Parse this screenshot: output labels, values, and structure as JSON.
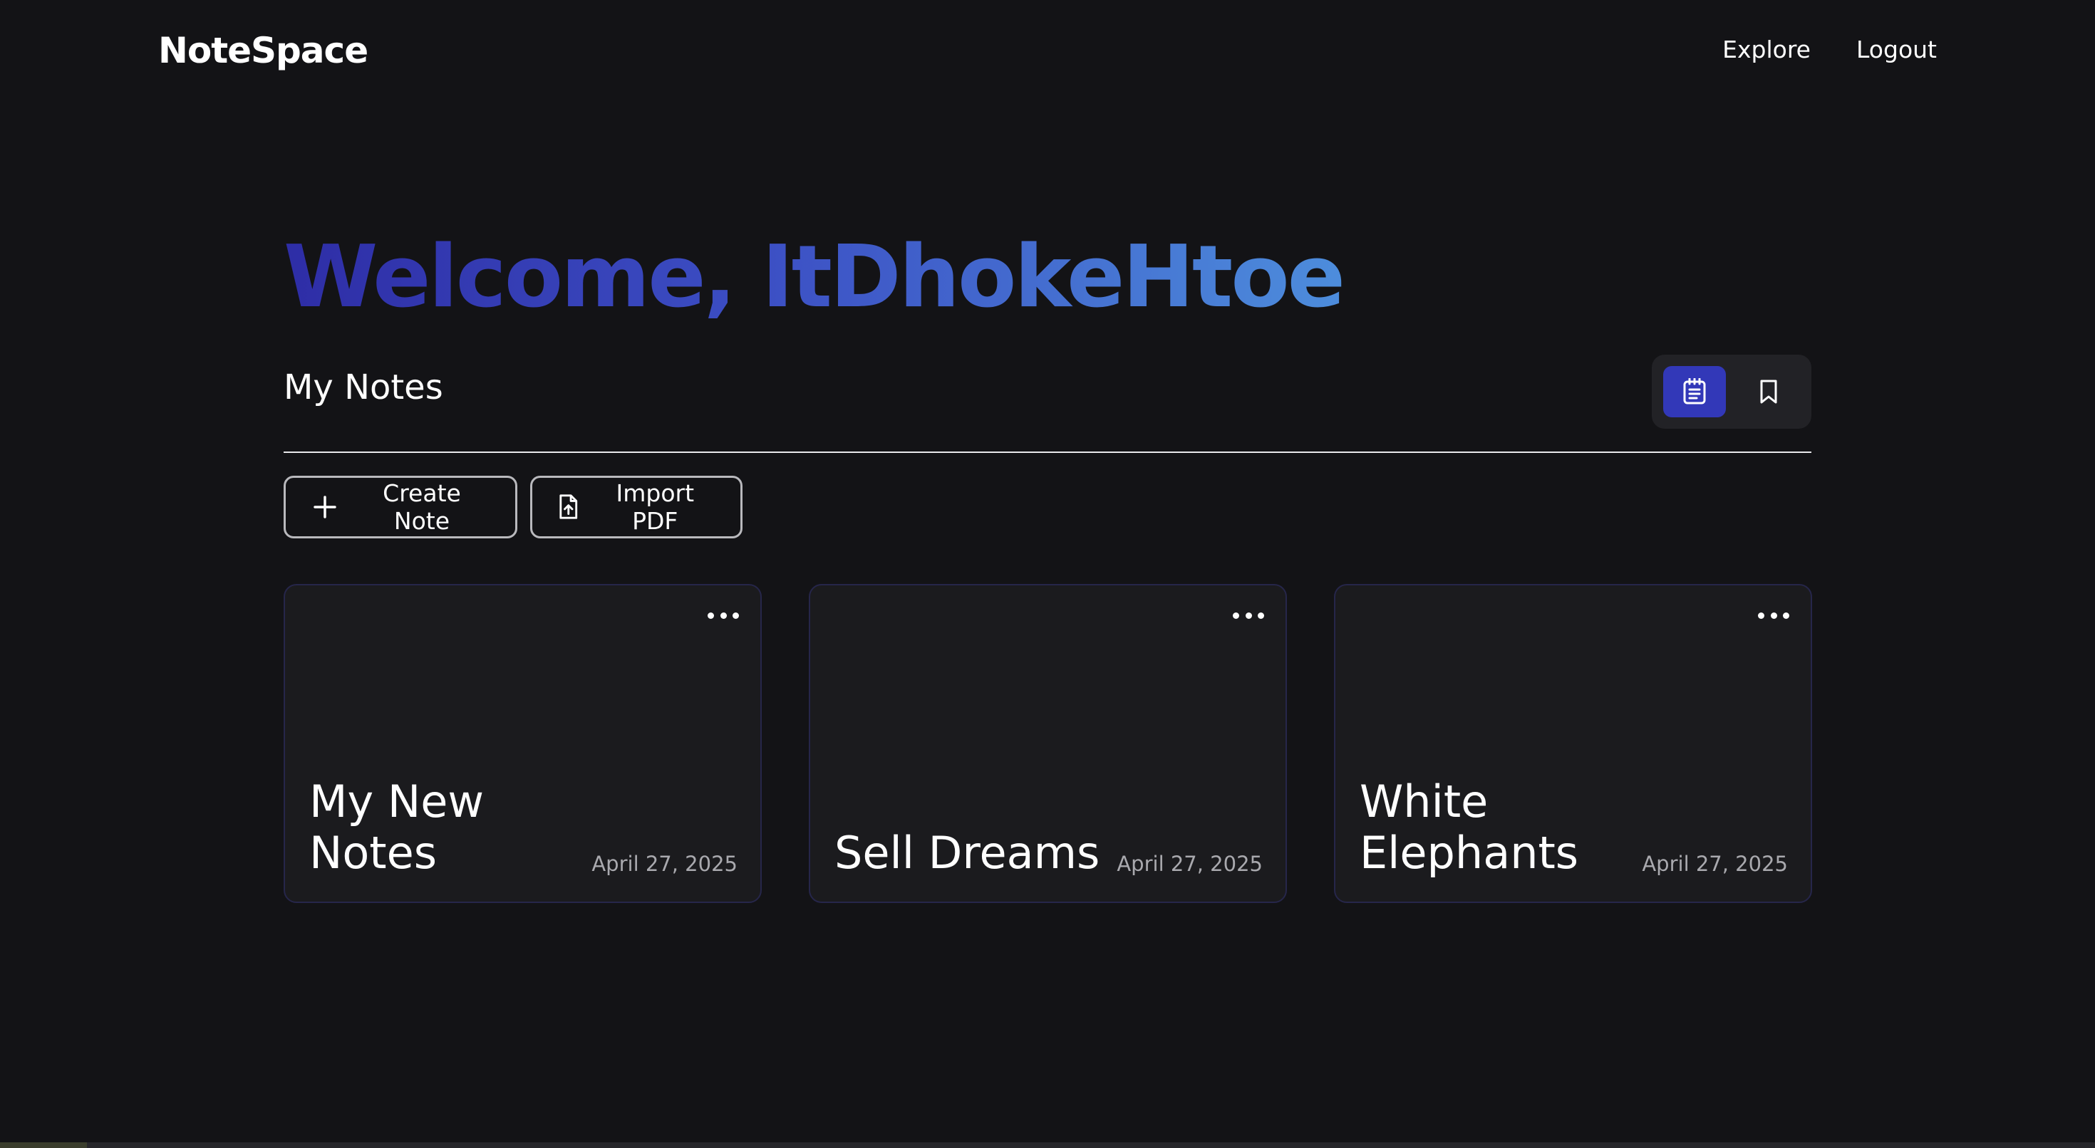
{
  "nav": {
    "logo": "NoteSpace",
    "links": [
      "Explore",
      "Logout"
    ]
  },
  "welcome": {
    "text": "Welcome, ItDhokeHtoe",
    "gradient": [
      "#2e2da6",
      "#3c4fc4",
      "#4d8ddc"
    ]
  },
  "notes_section": {
    "title": "My Notes",
    "view_toggle": [
      {
        "icon": "notepad-icon",
        "active": true
      },
      {
        "icon": "bookmark-icon",
        "active": false
      }
    ]
  },
  "actions": {
    "create_label": "Create Note",
    "import_label": "Import PDF"
  },
  "notes": [
    {
      "title": "My New Notes",
      "date": "April 27, 2025"
    },
    {
      "title": "Sell Dreams",
      "date": "April 27, 2025"
    },
    {
      "title": "White Elephants",
      "date": "April 27, 2025"
    }
  ],
  "colors": {
    "background": "#131316",
    "card": "#1b1b1e",
    "card_border": "#26264a",
    "accent": "#3238b8"
  }
}
